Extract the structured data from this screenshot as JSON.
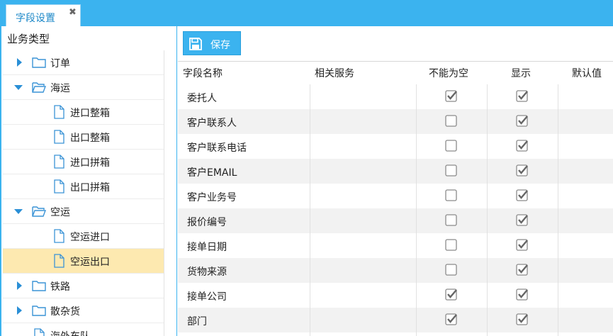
{
  "tab": {
    "title": "字段设置",
    "close_glyph": "✖"
  },
  "tree": {
    "title": "业务类型",
    "items": [
      {
        "label": "订单",
        "kind": "folder",
        "expanded": false,
        "level": 0
      },
      {
        "label": "海运",
        "kind": "folder",
        "expanded": true,
        "level": 0
      },
      {
        "label": "进口整箱",
        "kind": "file",
        "level": 1
      },
      {
        "label": "出口整箱",
        "kind": "file",
        "level": 1
      },
      {
        "label": "进口拼箱",
        "kind": "file",
        "level": 1
      },
      {
        "label": "出口拼箱",
        "kind": "file",
        "level": 1
      },
      {
        "label": "空运",
        "kind": "folder",
        "expanded": true,
        "level": 0
      },
      {
        "label": "空运进口",
        "kind": "file",
        "level": 1
      },
      {
        "label": "空运出口",
        "kind": "file",
        "level": 1,
        "selected": true
      },
      {
        "label": "铁路",
        "kind": "folder",
        "expanded": false,
        "level": 0
      },
      {
        "label": "散杂货",
        "kind": "folder",
        "expanded": false,
        "level": 0
      },
      {
        "label": "海外车队",
        "kind": "file",
        "level": 0
      }
    ]
  },
  "toolbar": {
    "save_label": "保存",
    "save_icon": "floppy-disk-icon"
  },
  "grid": {
    "columns": [
      "字段名称",
      "相关服务",
      "不能为空",
      "显示",
      "默认值"
    ],
    "rows": [
      {
        "name": "委托人",
        "required": true,
        "visible": true
      },
      {
        "name": "客户联系人",
        "required": false,
        "visible": true
      },
      {
        "name": "客户联系电话",
        "required": false,
        "visible": true
      },
      {
        "name": "客户EMAIL",
        "required": false,
        "visible": true
      },
      {
        "name": "客户业务号",
        "required": false,
        "visible": true
      },
      {
        "name": "报价编号",
        "required": false,
        "visible": true
      },
      {
        "name": "接单日期",
        "required": false,
        "visible": true
      },
      {
        "name": "货物来源",
        "required": false,
        "visible": true
      },
      {
        "name": "接单公司",
        "required": true,
        "visible": true
      },
      {
        "name": "部门",
        "required": true,
        "visible": true
      }
    ]
  },
  "colors": {
    "accent": "#3bb3ef",
    "selected_row": "#fde9b0",
    "tree_arrow": "#2a8fd6"
  }
}
